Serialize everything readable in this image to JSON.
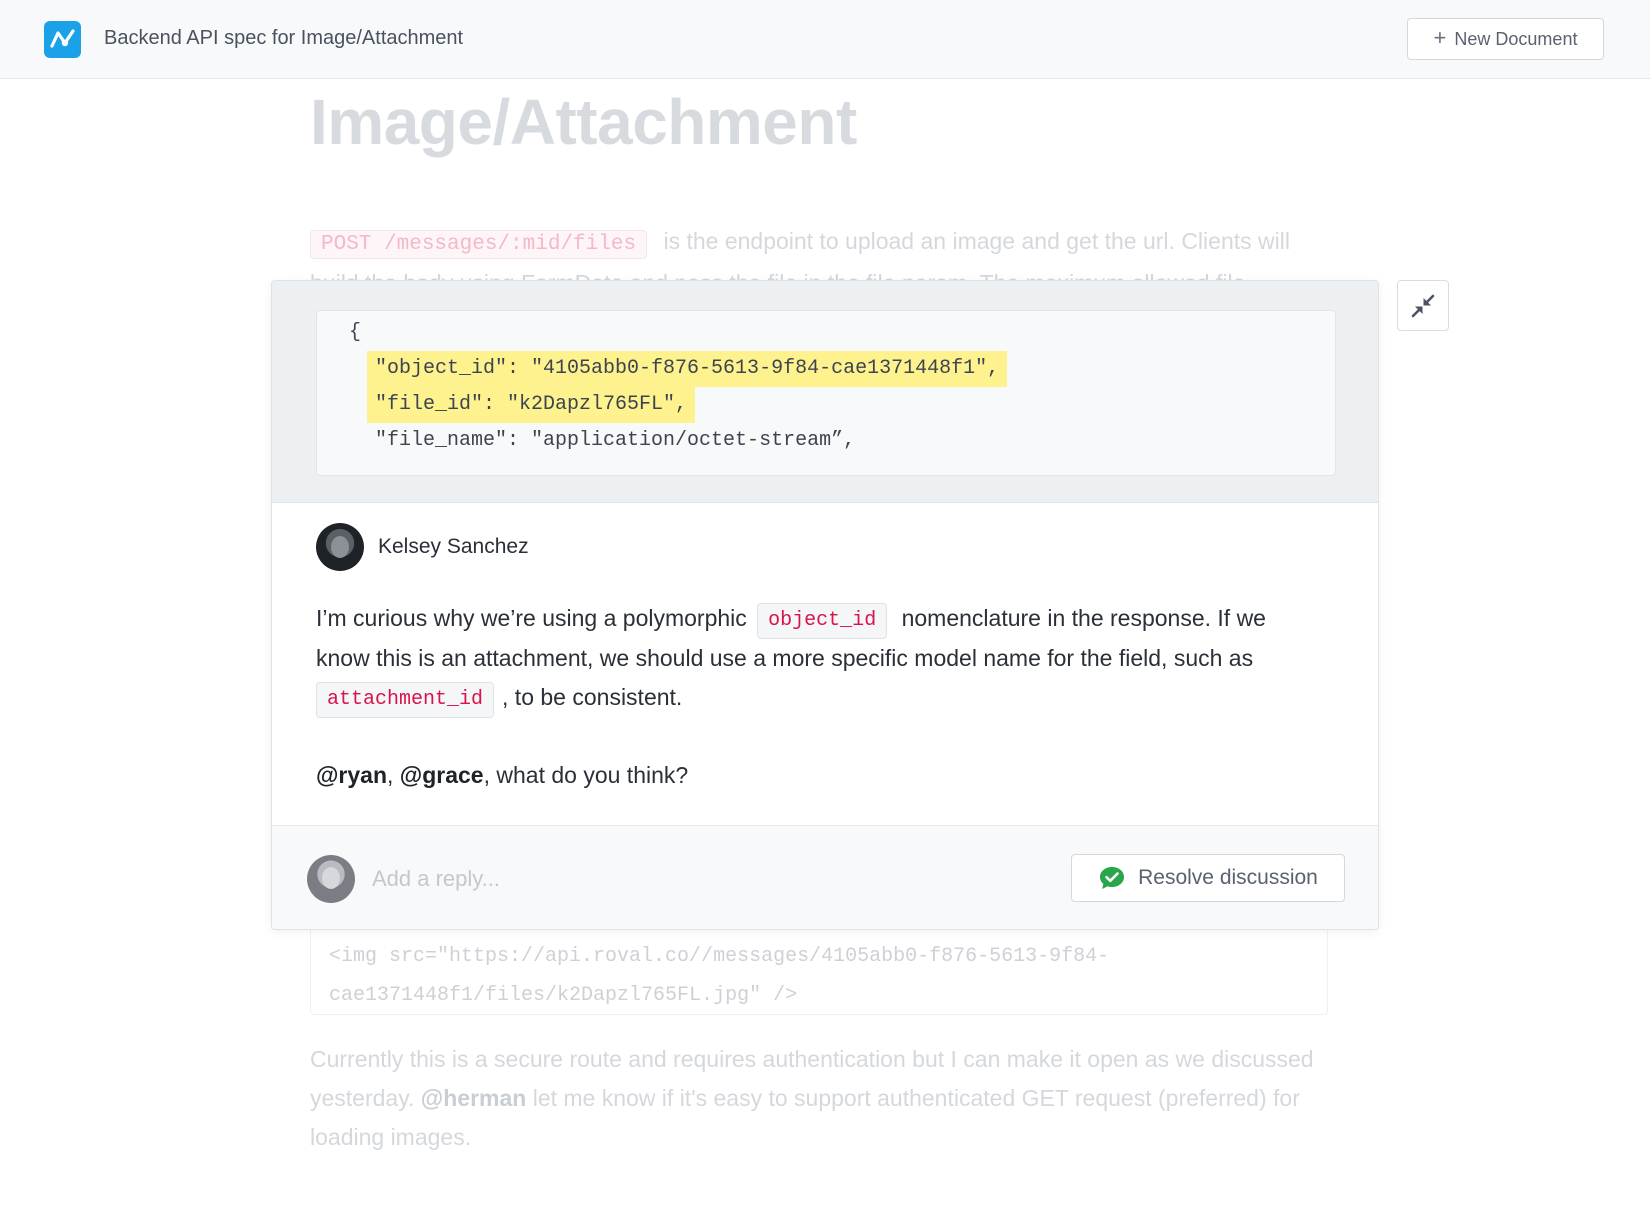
{
  "header": {
    "doc_title": "Backend API spec for Image/Attachment",
    "new_document_label": "New Document",
    "logo_icon": "chart-line-icon",
    "brand_color": "#1aa1e8"
  },
  "document": {
    "heading": "Image/Attachment",
    "intro_code": "POST /messages/:mid/files",
    "intro_text": " is the endpoint to upload an image and get the url. Clients will build the body using FormData and pass the file in the file param. The maximum allowed file",
    "img_code_line1": "<img src=\"https://api.roval.co//messages/4105abb0-f876-5613-9f84-",
    "img_code_line2": "cae1371448f1/files/k2Dapzl765FL.jpg\" />",
    "outro_text_1": "Currently this is a secure route and requires authentication but I can make it open as we discussed yesterday. ",
    "outro_mention": "@herman",
    "outro_text_2": " let me know if it's easy to support authenticated GET request (preferred) for loading images."
  },
  "discussion": {
    "snippet": {
      "brace": "{",
      "line1": "\"object_id\": \"4105abb0-f876-5613-9f84-cae1371448f1\",",
      "line2": "\"file_id\": \"k2Dapzl765FL\",",
      "line3": "\"file_name\": \"application/octet-stream”,"
    },
    "author": "Kelsey Sanchez",
    "body": {
      "part1": "I’m curious why we’re using a polymorphic ",
      "code1": "object_id",
      "part2": " nomenclature in the response. If we know this is an attachment, we should use a more specific model name for the field, such as ",
      "code2": "attachment_id",
      "part3": ", to be consistent."
    },
    "mentions": {
      "mention1": "@ryan",
      "sep": ", ",
      "mention2": "@grace",
      "tail": ", what do you think?"
    },
    "reply_placeholder": "Add a reply...",
    "resolve_label": "Resolve discussion",
    "resolve_icon_color": "#2aa64a",
    "highlight_color": "#fdf28e"
  },
  "collapse_icon": "collapse-arrows-icon"
}
